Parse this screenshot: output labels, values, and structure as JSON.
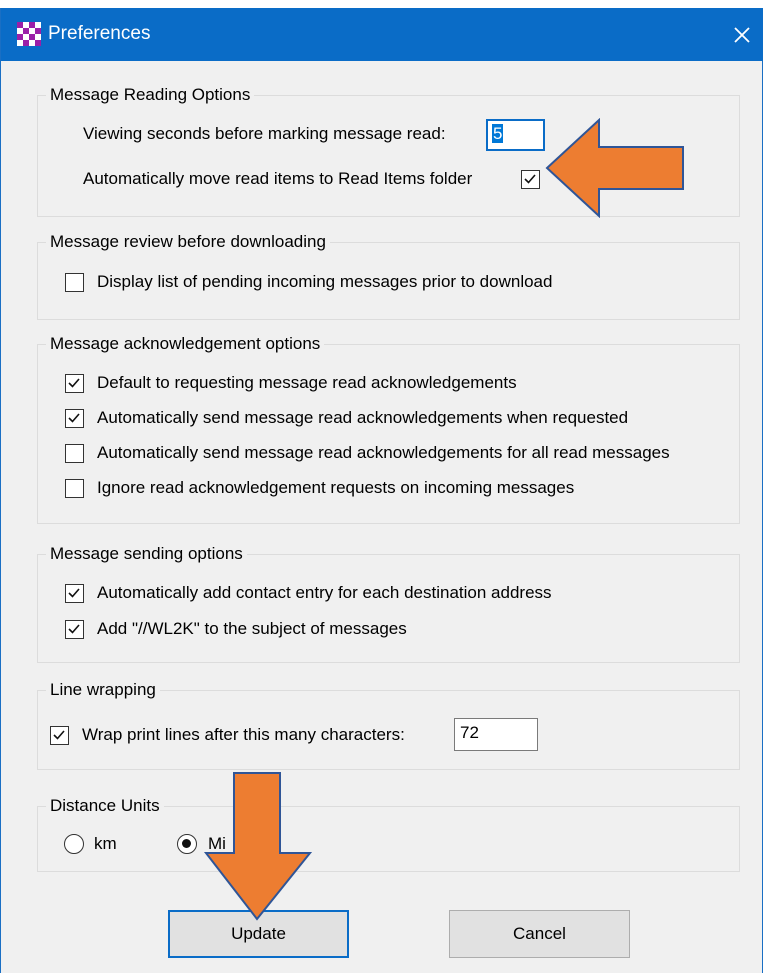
{
  "window": {
    "title": "Preferences"
  },
  "reading": {
    "title": "Message Reading Options",
    "viewing_label": "Viewing seconds before marking message read:",
    "viewing_value": "5",
    "move_label": "Automatically move read items to Read Items folder",
    "move_checked": true
  },
  "review": {
    "title": "Message review before downloading",
    "items": [
      {
        "label": "Display list of pending incoming messages prior to download",
        "checked": false
      }
    ]
  },
  "ack": {
    "title": "Message acknowledgement options",
    "items": [
      {
        "label": "Default to requesting message read acknowledgements",
        "checked": true
      },
      {
        "label": "Automatically send message read acknowledgements when requested",
        "checked": true
      },
      {
        "label": "Automatically send message read acknowledgements for all read messages",
        "checked": false
      },
      {
        "label": "Ignore read acknowledgement requests on incoming messages",
        "checked": false
      }
    ]
  },
  "sending": {
    "title": "Message sending options",
    "items": [
      {
        "label": "Automatically add contact entry for each destination address",
        "checked": true
      },
      {
        "label": "Add \"//WL2K\" to the subject of messages",
        "checked": true
      }
    ]
  },
  "wrapping": {
    "title": "Line wrapping",
    "label": "Wrap print lines after this many characters:",
    "checked": true,
    "value": "72"
  },
  "distance": {
    "title": "Distance Units",
    "options": [
      {
        "label": "km",
        "selected": false
      },
      {
        "label": "Mi",
        "selected": true
      }
    ]
  },
  "buttons": {
    "update": "Update",
    "cancel": "Cancel"
  },
  "colors": {
    "titlebar": "#0a6cc7",
    "arrow": "#ed7d31",
    "arrow_outline": "#2f5597"
  },
  "icons": {
    "app": "checkerboard-icon",
    "close": "close-icon",
    "check": "checkmark-icon"
  }
}
